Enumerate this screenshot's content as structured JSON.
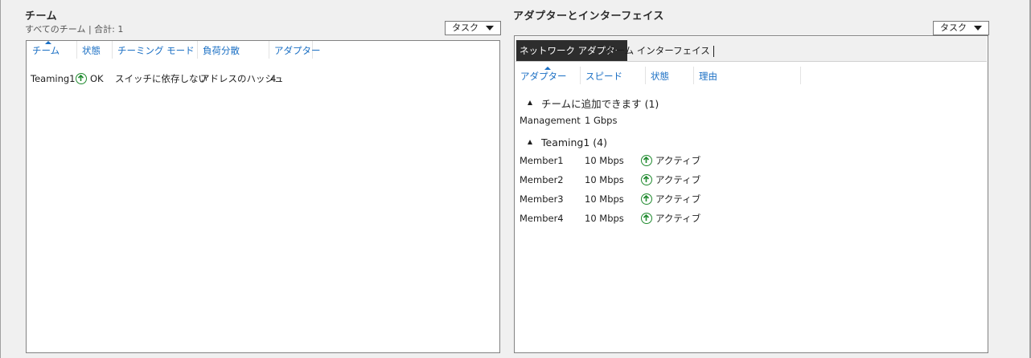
{
  "teams": {
    "title": "チーム",
    "summary": "すべてのチーム | 合計: 1",
    "task_label": "タスク",
    "columns": [
      "チーム",
      "状態",
      "チーミング モード",
      "負荷分散",
      "アダプター"
    ],
    "rows": [
      {
        "team": "Teaming1",
        "status": "OK",
        "mode": "スイッチに依存しない",
        "load_balancing": "アドレスのハッシュ",
        "adapters": "4"
      }
    ]
  },
  "adapters": {
    "title": "アダプターとインターフェイス",
    "task_label": "タスク",
    "tabs": [
      "ネットワーク アダプター",
      "チーム インターフェイス"
    ],
    "active_tab": 0,
    "columns": [
      "アダプター",
      "スピード",
      "状態",
      "理由"
    ],
    "groups": [
      {
        "header": "チームに追加できます (1)",
        "rows": [
          {
            "adapter": "Management",
            "speed": "1 Gbps",
            "status": "",
            "reason": ""
          }
        ]
      },
      {
        "header": "Teaming1 (4)",
        "rows": [
          {
            "adapter": "Member1",
            "speed": "10 Mbps",
            "status": "アクティブ",
            "reason": ""
          },
          {
            "adapter": "Member2",
            "speed": "10 Mbps",
            "status": "アクティブ",
            "reason": ""
          },
          {
            "adapter": "Member3",
            "speed": "10 Mbps",
            "status": "アクティブ",
            "reason": ""
          },
          {
            "adapter": "Member4",
            "speed": "10 Mbps",
            "status": "アクティブ",
            "reason": ""
          }
        ]
      }
    ]
  },
  "colors": {
    "link_blue": "#1a6fc4",
    "status_green": "#1f8a2e",
    "active_tab": "#2d2d2d"
  }
}
